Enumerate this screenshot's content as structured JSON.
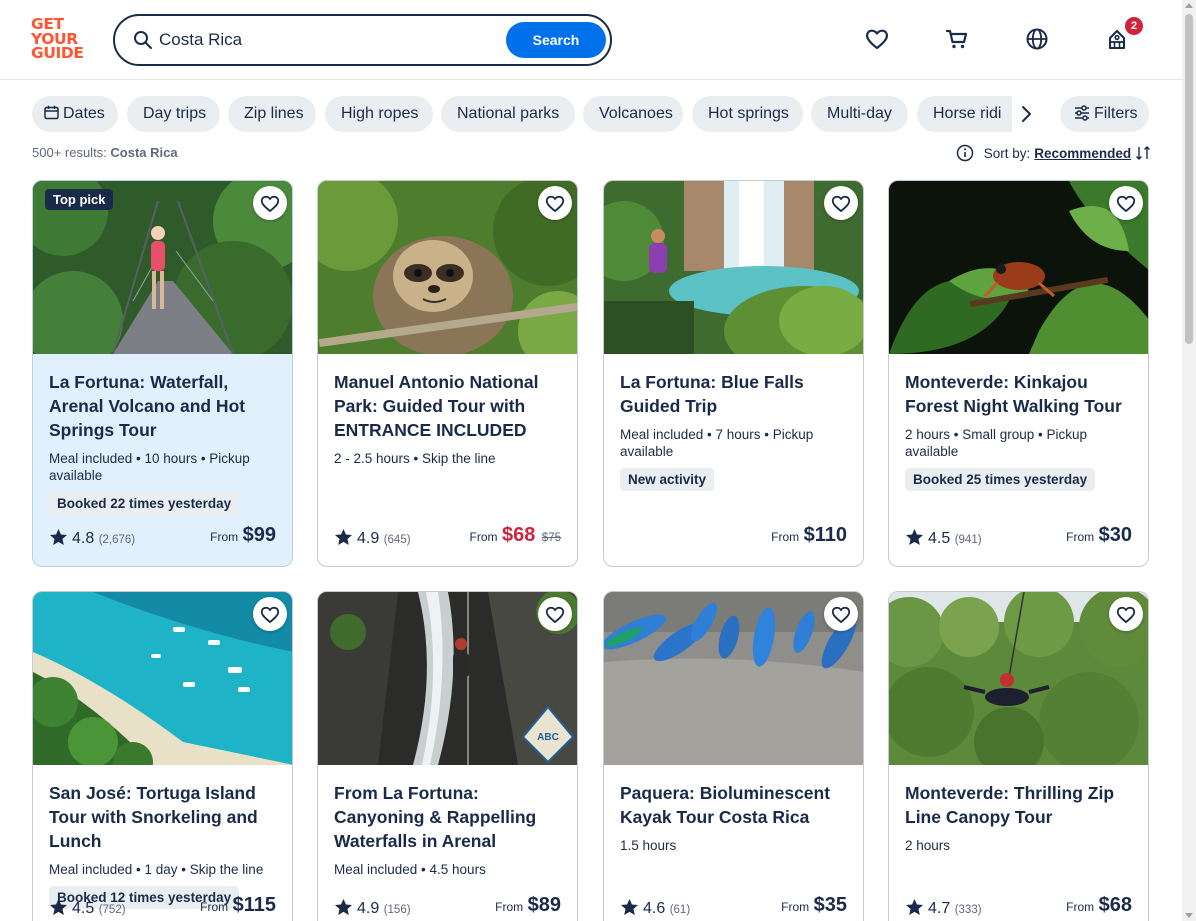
{
  "header": {
    "logo_lines": [
      "GET",
      "YOUR",
      "GUIDE"
    ],
    "search_value": "Costa Rica",
    "search_button": "Search",
    "cart_badge": "2"
  },
  "chips": [
    "Dates",
    "Day trips",
    "Zip lines",
    "High ropes",
    "National parks",
    "Volcanoes",
    "Hot springs",
    "Multi-day",
    "Horse ridi"
  ],
  "filters_label": "Filters",
  "results": {
    "count": "500+ results:",
    "query": "Costa Rica"
  },
  "sort": {
    "label": "Sort by:",
    "value": "Recommended"
  },
  "colors": {
    "brand": "#ff5533",
    "accent": "#0071eb",
    "sale": "#d0243c",
    "text": "#1a2b49",
    "highlight": "#e2effc"
  },
  "cards": [
    {
      "badge": "Top pick",
      "title": "La Fortuna: Waterfall, Arenal Volcano and Hot Springs Tour",
      "meta": "Meal included • 10 hours • Pickup available",
      "tag": "Booked 22 times yesterday",
      "rating": "4.8",
      "reviews": "(2,676)",
      "from": "From",
      "price": "$99",
      "old_price": ""
    },
    {
      "badge": "",
      "title": "Manuel Antonio National Park: Guided Tour with ENTRANCE INCLUDED",
      "meta": "2 - 2.5 hours • Skip the line",
      "tag": "",
      "rating": "4.9",
      "reviews": "(645)",
      "from": "From",
      "price": "$68",
      "old_price": "$75"
    },
    {
      "badge": "",
      "title": "La Fortuna: Blue Falls Guided Trip",
      "meta": "Meal included • 7 hours • Pickup available",
      "tag": "New activity",
      "rating": "",
      "reviews": "",
      "from": "From",
      "price": "$110",
      "old_price": ""
    },
    {
      "badge": "",
      "title": "Monteverde: Kinkajou Forest Night Walking Tour",
      "meta": "2 hours • Small group • Pickup available",
      "tag": "Booked 25 times yesterday",
      "rating": "4.5",
      "reviews": "(941)",
      "from": "From",
      "price": "$30",
      "old_price": ""
    },
    {
      "badge": "",
      "title": "San José: Tortuga Island Tour with Snorkeling and Lunch",
      "meta": "Meal included • 1 day • Skip the line",
      "tag": "Booked 12 times yesterday",
      "rating": "4.5",
      "reviews": "(752)",
      "from": "From",
      "price": "$115",
      "old_price": ""
    },
    {
      "badge": "",
      "title": "From La Fortuna: Canyoning & Rappelling Waterfalls in Arenal",
      "meta": "Meal included • 4.5 hours",
      "tag": "",
      "rating": "4.9",
      "reviews": "(156)",
      "from": "From",
      "price": "$89",
      "old_price": ""
    },
    {
      "badge": "",
      "title": "Paquera: Bioluminescent Kayak Tour Costa Rica",
      "meta": "1.5 hours",
      "tag": "",
      "rating": "4.6",
      "reviews": "(61)",
      "from": "From",
      "price": "$35",
      "old_price": ""
    },
    {
      "badge": "",
      "title": "Monteverde: Thrilling Zip Line Canopy Tour",
      "meta": "2 hours",
      "tag": "",
      "rating": "4.7",
      "reviews": "(333)",
      "from": "From",
      "price": "$68",
      "old_price": ""
    }
  ],
  "image_watermark": "ABC"
}
